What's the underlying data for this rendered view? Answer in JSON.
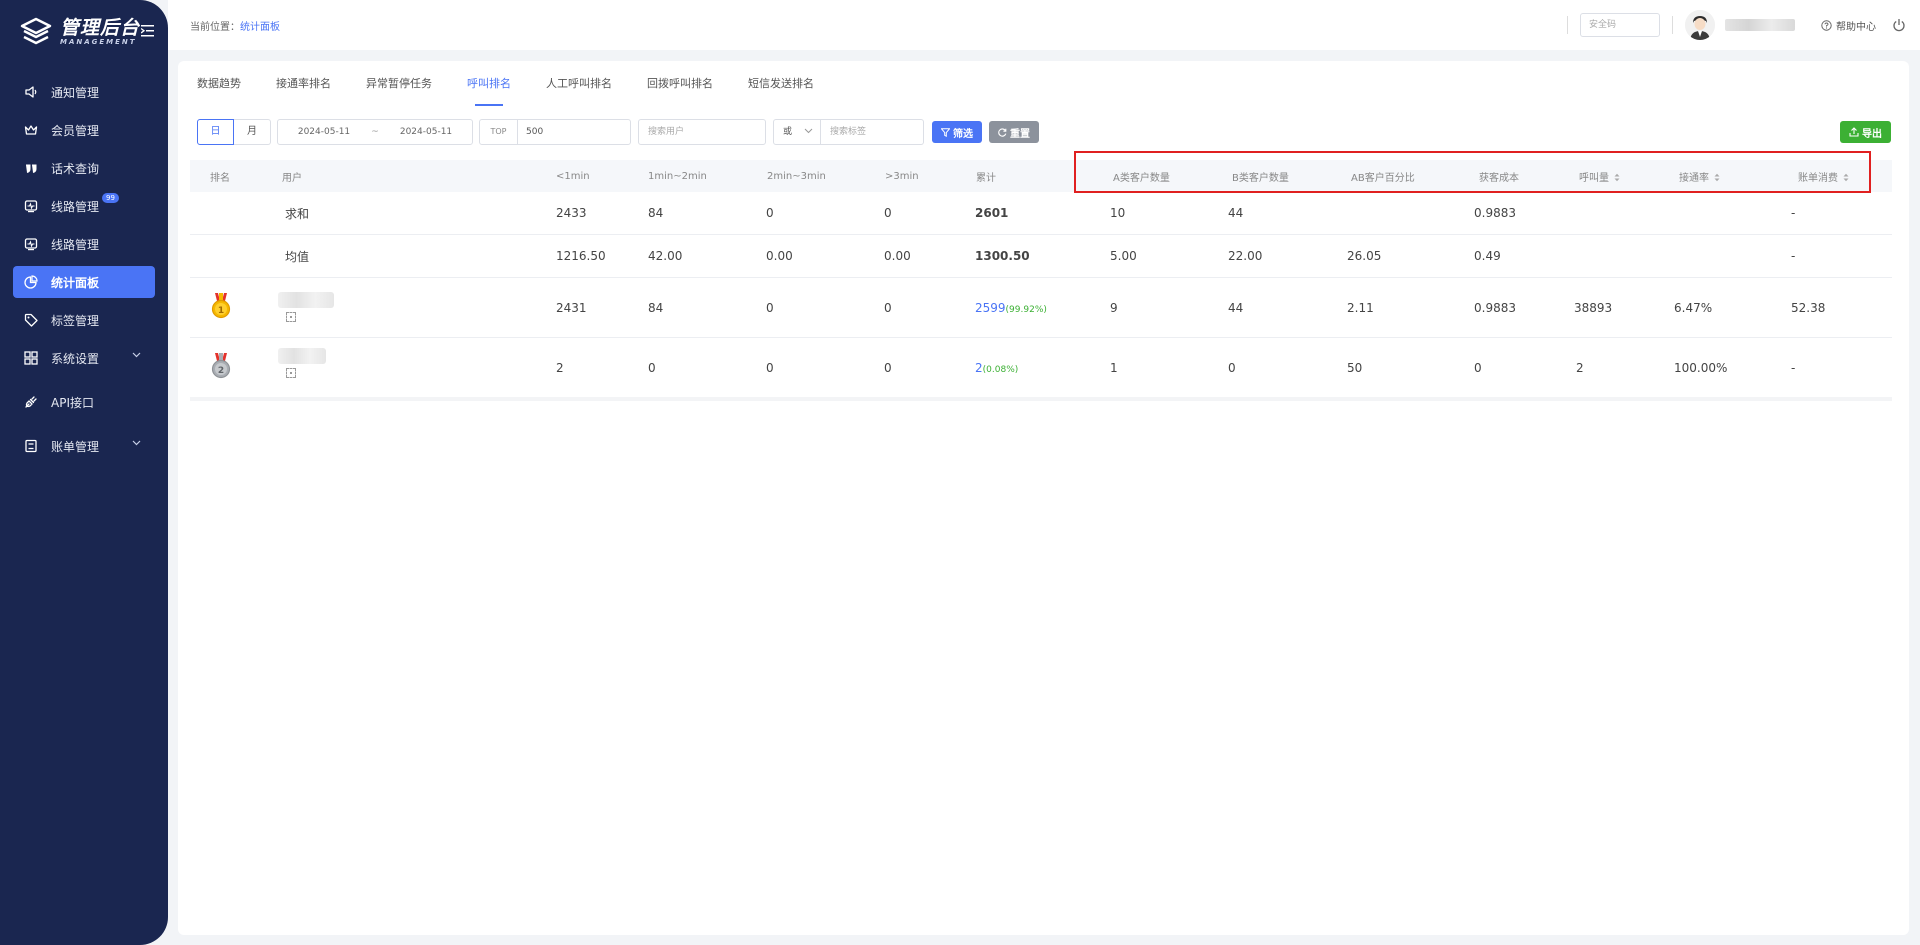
{
  "app": {
    "logo_title": "管理后台",
    "logo_sub": "MANAGEMENT"
  },
  "sidebar": {
    "items": [
      {
        "label": "通知管理",
        "icon": "speaker-icon"
      },
      {
        "label": "会员管理",
        "icon": "crown-icon"
      },
      {
        "label": "话术查询",
        "icon": "quote-icon"
      },
      {
        "label": "线路管理",
        "icon": "line-icon",
        "badge": "99"
      },
      {
        "label": "线路管理",
        "icon": "line-icon"
      },
      {
        "label": "统计面板",
        "icon": "pie-chart-icon",
        "active": true
      },
      {
        "label": "标签管理",
        "icon": "tag-icon"
      },
      {
        "label": "系统设置",
        "icon": "grid-icon",
        "expandable": true
      },
      {
        "label": "API接口",
        "icon": "plug-icon"
      },
      {
        "label": "账单管理",
        "icon": "book-icon",
        "expandable": true
      }
    ]
  },
  "header": {
    "crumb_prefix": "当前位置：",
    "crumb_current": "统计面板",
    "safe_placeholder": "安全码",
    "help_label": "帮助中心"
  },
  "tabs": [
    "数据趋势",
    "接通率排名",
    "异常暂停任务",
    "呼叫排名",
    "人工呼叫排名",
    "回拨呼叫排名",
    "短信发送排名"
  ],
  "active_tab": "呼叫排名",
  "filters": {
    "day": "日",
    "month": "月",
    "date_start": "2024-05-11",
    "date_sep": "~",
    "date_end": "2024-05-11",
    "top_label": "TOP",
    "top_value": "500",
    "user_placeholder": "搜索用户",
    "or_value": "或",
    "tag_placeholder": "搜索标签",
    "filter_btn": "筛选",
    "reset_btn": "重置",
    "export_btn": "导出"
  },
  "table": {
    "headers": [
      "排名",
      "用户",
      "<1min",
      "1min~2min",
      "2min~3min",
      ">3min",
      "累计",
      "A类客户数量",
      "B类客户数量",
      "AB客户百分比",
      "获客成本",
      "呼叫量",
      "接通率",
      "账单消费"
    ],
    "sum_row": {
      "label": "求和",
      "lt1": "2433",
      "m1_2": "84",
      "m2_3": "0",
      "gt3": "0",
      "total": "2601",
      "a": "10",
      "b": "44",
      "ab": "",
      "cost": "0.9883",
      "calls": "",
      "rate": "",
      "bill": "-"
    },
    "avg_row": {
      "label": "均值",
      "lt1": "1216.50",
      "m1_2": "42.00",
      "m2_3": "0.00",
      "gt3": "0.00",
      "total": "1300.50",
      "a": "5.00",
      "b": "22.00",
      "ab": "26.05",
      "cost": "0.49",
      "calls": "",
      "rate": "",
      "bill": "-"
    },
    "rows": [
      {
        "rank": "1",
        "lt1": "2431",
        "m1_2": "84",
        "m2_3": "0",
        "gt3": "0",
        "total": "2599",
        "total_pct": "(99.92%)",
        "a": "9",
        "b": "44",
        "ab": "2.11",
        "cost": "0.9883",
        "calls": "38893",
        "rate": "6.47%",
        "bill": "52.38"
      },
      {
        "rank": "2",
        "lt1": "2",
        "m1_2": "0",
        "m2_3": "0",
        "gt3": "0",
        "total": "2",
        "total_pct": "(0.08%)",
        "a": "1",
        "b": "0",
        "ab": "50",
        "cost": "0",
        "calls": "2",
        "rate": "100.00%",
        "bill": "-"
      }
    ]
  },
  "colors": {
    "accent": "#4a74f5",
    "sidebar": "#1a2650",
    "export": "#3cb034",
    "highlight": "#e02020",
    "gold": "#f5b800",
    "silver": "#a9adb3"
  }
}
